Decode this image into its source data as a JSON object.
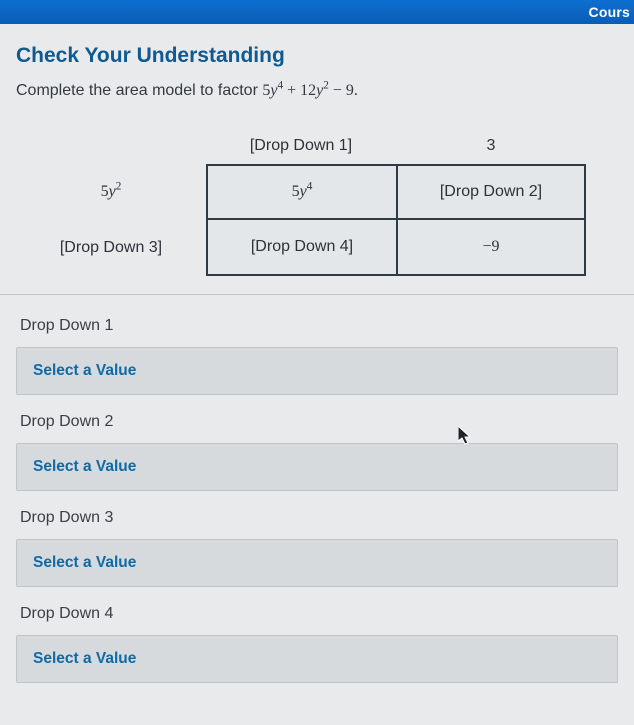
{
  "topbar": {
    "course_label": "Cours"
  },
  "heading": "Check Your Understanding",
  "prompt_prefix": "Complete the area model to factor ",
  "expression_html": "5y⁴ + 12y² − 9.",
  "area_model": {
    "col_headers": {
      "c1": "[Drop Down 1]",
      "c2": "3"
    },
    "row_headers": {
      "r1": "5y²",
      "r2": "[Drop Down 3]"
    },
    "cells": {
      "r1c1": "5y⁴",
      "r1c2": "[Drop Down 2]",
      "r2c1": "[Drop Down 4]",
      "r2c2": "−9"
    }
  },
  "dropdowns": [
    {
      "label": "Drop Down 1",
      "placeholder": "Select a Value"
    },
    {
      "label": "Drop Down 2",
      "placeholder": "Select a Value"
    },
    {
      "label": "Drop Down 3",
      "placeholder": "Select a Value"
    },
    {
      "label": "Drop Down 4",
      "placeholder": "Select a Value"
    }
  ]
}
